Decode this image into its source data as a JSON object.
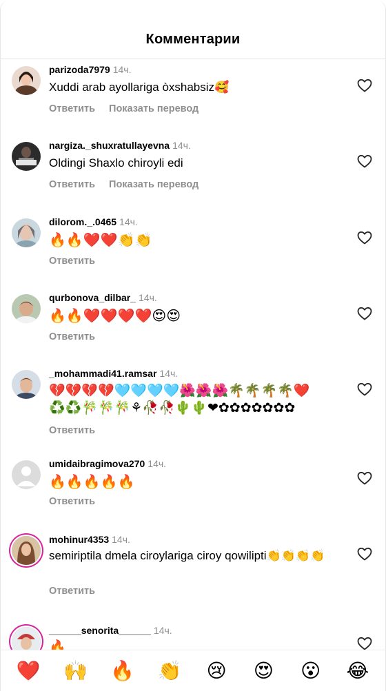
{
  "header": {
    "title": "Комментарии"
  },
  "labels": {
    "reply": "Ответить",
    "translate": "Показать перевод"
  },
  "comments": [
    {
      "username": "parizoda7979",
      "time": "14ч.",
      "text": "Xuddi arab ayollariga òxshabsiz🥰",
      "translate": true,
      "avatar": "photo-woman"
    },
    {
      "username": "nargiza._shuxratullayevna",
      "time": "14ч.",
      "text": "Oldingi Shaxlo chiroyli edi",
      "translate": true,
      "avatar": "photo-dark"
    },
    {
      "username": "dilorom._.0465",
      "time": "14ч.",
      "text": "🔥🔥❤️❤️👏👏",
      "translate": false,
      "avatar": "photo-woman-light"
    },
    {
      "username": "qurbonova_dilbar_",
      "time": "14ч.",
      "text": "🔥🔥❤️❤️❤️❤️😍😍",
      "translate": false,
      "avatar": "photo-woman-tan"
    },
    {
      "username": "_mohammadi41.ramsar",
      "time": "14ч.",
      "text": "💔💔💔💔🩵🩵🩵🩵🌺🌺🌺🌴🌴🌴🌴❤️♻️♻️🎋🎋🎋⚘🥀🥀🌵🌵❤✿✿✿✿✿✿✿",
      "translate": false,
      "avatar": "photo-man"
    },
    {
      "username": "umidaibragimova270",
      "time": "14ч.",
      "text": "🔥🔥🔥🔥🔥",
      "translate": false,
      "avatar": "default"
    },
    {
      "username": "mohinur4353",
      "time": "14ч.",
      "text": "semiriptila dmela ciroylariga ciroy qowilipti👏👏👏👏",
      "translate": false,
      "avatar": "photo-hair"
    },
    {
      "username": "______senorita______",
      "time": "14ч.",
      "text": "🔥",
      "translate": false,
      "avatar": "photo-hat"
    }
  ],
  "reactions": [
    "❤️",
    "🙌",
    "🔥",
    "👏",
    "😢",
    "😍",
    "😮",
    "😂"
  ],
  "colors": {
    "story_ring": "#d6249f",
    "secondary_text": "#8e8e8e"
  }
}
